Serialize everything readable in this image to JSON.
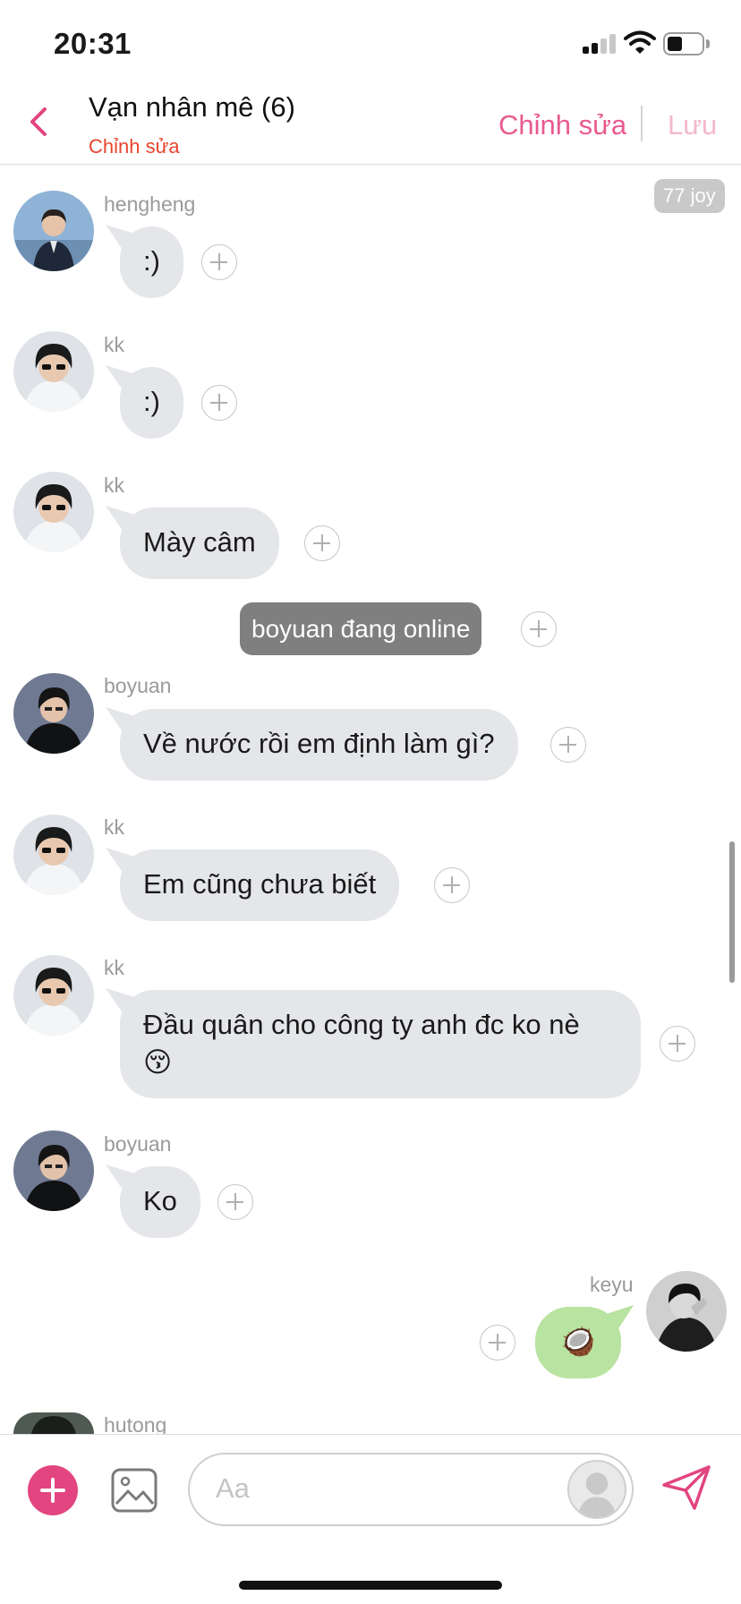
{
  "status_bar": {
    "time": "20:31"
  },
  "header": {
    "title": "Vạn nhân mê (6)",
    "subtitle": "Chỉnh sửa",
    "edit_label": "Chỉnh sửa",
    "save_label": "Lưu"
  },
  "joy_badge": "77 joy",
  "system_notice": "boyuan đang online",
  "messages": [
    {
      "sender": "hengheng",
      "text": ":)"
    },
    {
      "sender": "kk",
      "text": ":)"
    },
    {
      "sender": "kk",
      "text": "Mày câm"
    },
    {
      "sender": "boyuan",
      "text": "Về nước rồi em định làm gì?"
    },
    {
      "sender": "kk",
      "text": "Em cũng chưa biết"
    },
    {
      "sender": "kk",
      "text_line1": "Đầu quân cho công ty anh đc ko nè",
      "text_line2": "😚"
    },
    {
      "sender": "boyuan",
      "text": "Ko"
    },
    {
      "sender": "keyu",
      "text": "🥥"
    },
    {
      "sender": "hutong"
    }
  ],
  "input": {
    "placeholder": "Aa"
  },
  "colors": {
    "accent": "#e2457f",
    "subtitle_red": "#e8452c",
    "bubble_in": "#e4e6e9",
    "bubble_out": "#b8e3a0"
  }
}
